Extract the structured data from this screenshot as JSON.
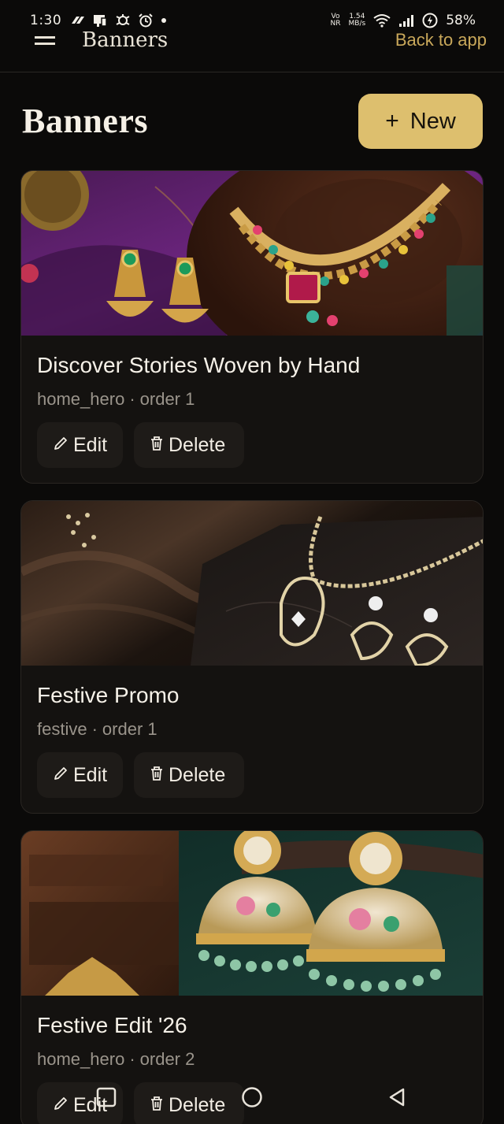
{
  "status_bar": {
    "time": "1:30",
    "net_speed_top": "1.54",
    "net_speed_bottom": "MB/s",
    "network_label_top": "Vo",
    "network_label_bottom": "NR",
    "battery": "58%"
  },
  "header": {
    "title": "Banners",
    "back_label": "Back to app"
  },
  "page": {
    "title": "Banners",
    "new_button_label": "New",
    "new_button_icon": "+"
  },
  "banners": [
    {
      "title": "Discover Stories Woven by Hand",
      "placement": "home_hero",
      "separator": "·",
      "order": "order 1",
      "edit_label": "Edit",
      "delete_label": "Delete"
    },
    {
      "title": "Festive Promo",
      "placement": "festive",
      "separator": "·",
      "order": "order 1",
      "edit_label": "Edit",
      "delete_label": "Delete"
    },
    {
      "title": "Festive Edit '26",
      "placement": "home_hero",
      "separator": "·",
      "order": "order 2",
      "edit_label": "Edit",
      "delete_label": "Delete"
    }
  ],
  "colors": {
    "background": "#0b0a09",
    "accent": "#ddbf6e",
    "card": "#141210",
    "muted_text": "#9a948b"
  },
  "icons": {
    "menu": "hamburger-menu-icon",
    "new": "plus-icon",
    "edit": "pencil-icon",
    "delete": "trash-icon",
    "nav_recents": "recents-square-icon",
    "nav_home": "home-circle-icon",
    "nav_back": "back-triangle-icon"
  }
}
